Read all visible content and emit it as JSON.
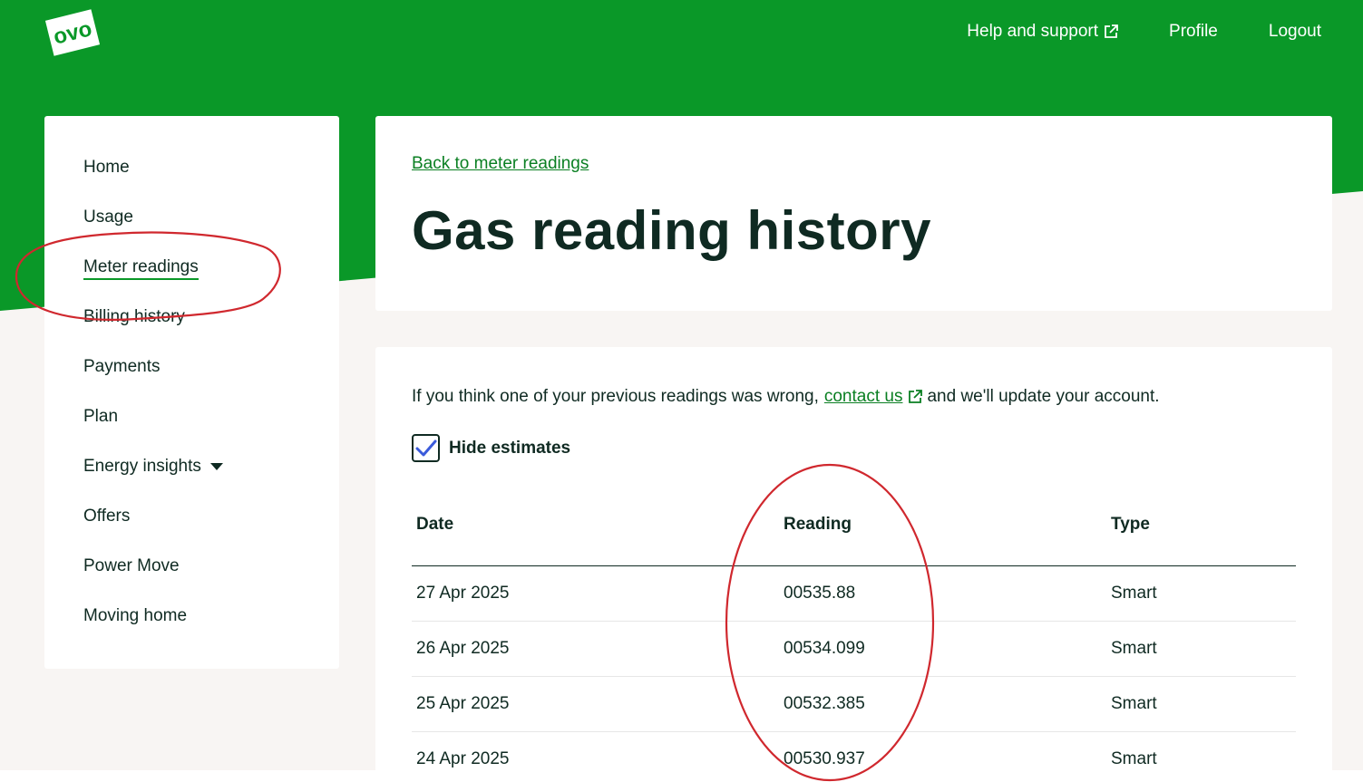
{
  "header": {
    "logo_text": "ovo",
    "nav": {
      "help_label": "Help and support",
      "profile_label": "Profile",
      "logout_label": "Logout"
    }
  },
  "sidebar": {
    "items": [
      {
        "label": "Home"
      },
      {
        "label": "Usage"
      },
      {
        "label": "Meter readings",
        "active": true
      },
      {
        "label": "Billing history"
      },
      {
        "label": "Payments"
      },
      {
        "label": "Plan"
      },
      {
        "label": "Energy insights",
        "has_dropdown": true
      },
      {
        "label": "Offers"
      },
      {
        "label": "Power Move"
      },
      {
        "label": "Moving home"
      }
    ]
  },
  "title_card": {
    "back_link": "Back to meter readings",
    "title": "Gas reading history"
  },
  "content": {
    "info_before": "If you think one of your previous readings was wrong,",
    "contact_link": "contact us",
    "info_after": "and we'll update your account.",
    "hide_estimates_label": "Hide estimates",
    "hide_estimates_checked": true,
    "table": {
      "headers": [
        "Date",
        "Reading",
        "Type"
      ],
      "rows": [
        [
          "27 Apr 2025",
          "00535.88",
          "Smart"
        ],
        [
          "26 Apr 2025",
          "00534.099",
          "Smart"
        ],
        [
          "25 Apr 2025",
          "00532.385",
          "Smart"
        ],
        [
          "24 Apr 2025",
          "00530.937",
          "Smart"
        ]
      ]
    }
  },
  "colors": {
    "brand_green": "#0a9828",
    "link_green": "#0a7f22",
    "text_dark": "#0f2a22",
    "annotation_red": "#d0282e"
  },
  "icons": [
    "external-link-icon",
    "checkmark-icon",
    "caret-down-icon",
    "ovo-logo"
  ]
}
